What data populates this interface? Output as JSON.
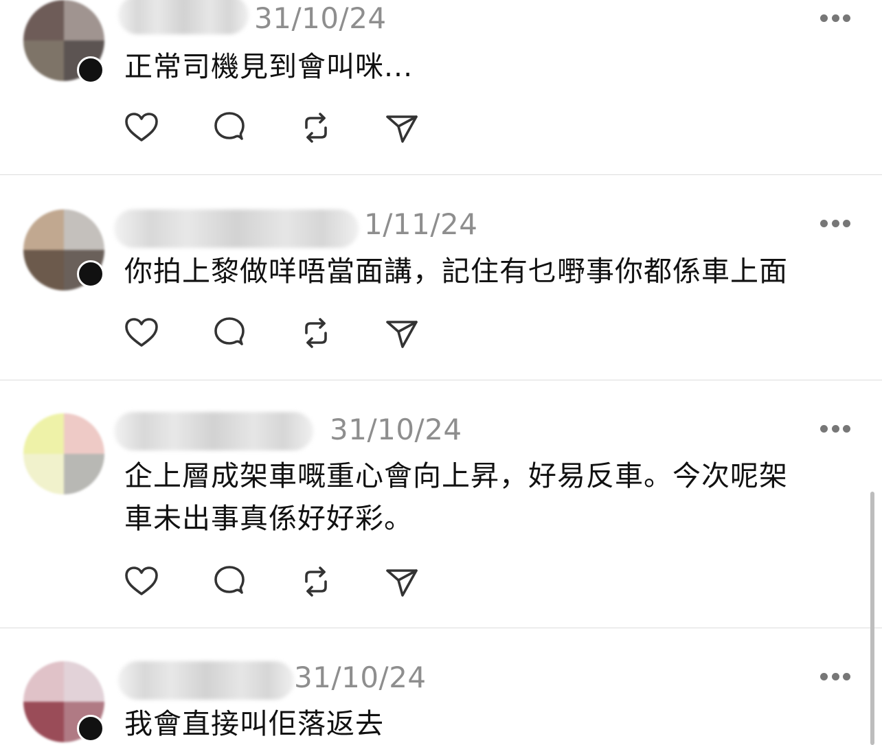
{
  "posts": [
    {
      "date": "31/10/24",
      "text": "正常司機見到會叫咪...",
      "avatar_colors": [
        "#6e5c58",
        "#a09490",
        "#7e7468",
        "#5c5452"
      ]
    },
    {
      "date": "1/11/24",
      "text": "你拍上黎做咩唔當面講，記住有乜嘢事你都係車上面",
      "avatar_colors": [
        "#c1a890",
        "#c4c0bc",
        "#6c5a4c",
        "#6a605a"
      ]
    },
    {
      "date": "31/10/24",
      "text": "企上層成架車嘅重心會向上昇，好易反車。今次呢架\n車未出事真係好好彩。",
      "avatar_colors": [
        "#eef2a8",
        "#eecac6",
        "#f1f2cc",
        "#b8b8b4"
      ]
    },
    {
      "date": "31/10/24",
      "text": "我會直接叫佢落返去",
      "avatar_colors": [
        "#e0c2c8",
        "#e2d2d8",
        "#9a4c58",
        "#b07a84"
      ]
    }
  ],
  "icons": {
    "like": "heart-icon",
    "reply": "comment-icon",
    "repost": "repost-icon",
    "share": "send-icon",
    "more": "more-icon"
  }
}
